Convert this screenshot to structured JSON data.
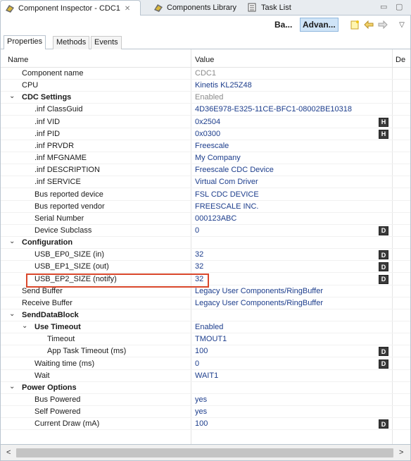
{
  "tabs": [
    {
      "label": "Component Inspector - CDC1",
      "icon": "component-inspector-icon",
      "active": true,
      "close": "✕"
    },
    {
      "label": "Components Library",
      "icon": "components-library-icon",
      "active": false
    },
    {
      "label": "Task List",
      "icon": "task-list-icon",
      "active": false
    }
  ],
  "window_controls": {
    "minimize": "▭",
    "maximize": "▢"
  },
  "toolbar": {
    "basic_label": "Ba...",
    "advanced_label": "Advan...",
    "menu_icon": "▽"
  },
  "subtabs": [
    "Properties",
    "Methods",
    "Events"
  ],
  "columns": {
    "name": "Name",
    "value": "Value",
    "details": "De"
  },
  "rows": [
    {
      "name": "Component name",
      "value": "CDC1",
      "indent": 1,
      "gray": true
    },
    {
      "name": "CPU",
      "value": "Kinetis KL25Z48",
      "indent": 1
    },
    {
      "name": "CDC Settings",
      "value": "Enabled",
      "indent": 0,
      "bold": true,
      "expanded": true,
      "gray": true
    },
    {
      "name": ".inf ClassGuid",
      "value": "4D36E978-E325-11CE-BFC1-08002BE10318",
      "indent": 2
    },
    {
      "name": ".inf VID",
      "value": "0x2504",
      "indent": 2,
      "badge": "H"
    },
    {
      "name": ".inf PID",
      "value": "0x0300",
      "indent": 2,
      "badge": "H"
    },
    {
      "name": ".inf PRVDR",
      "value": "Freescale",
      "indent": 2
    },
    {
      "name": ".inf MFGNAME",
      "value": "My Company",
      "indent": 2
    },
    {
      "name": ".inf DESCRIPTION",
      "value": "Freescale CDC Device",
      "indent": 2
    },
    {
      "name": ".inf SERVICE",
      "value": "Virtual Com Driver",
      "indent": 2
    },
    {
      "name": "Bus reported device",
      "value": "FSL CDC DEVICE",
      "indent": 2
    },
    {
      "name": "Bus reported vendor",
      "value": "FREESCALE INC.",
      "indent": 2
    },
    {
      "name": "Serial Number",
      "value": "000123ABC",
      "indent": 2
    },
    {
      "name": "Device Subclass",
      "value": "0",
      "indent": 2,
      "badge": "D"
    },
    {
      "name": "Configuration",
      "value": "",
      "indent": 0,
      "bold": true,
      "expanded": true
    },
    {
      "name": "USB_EP0_SIZE (in)",
      "value": "32",
      "indent": 2,
      "badge": "D"
    },
    {
      "name": "USB_EP1_SIZE (out)",
      "value": "32",
      "indent": 2,
      "badge": "D"
    },
    {
      "name": "USB_EP2_SIZE (notify)",
      "value": "32",
      "indent": 2,
      "badge": "D"
    },
    {
      "name": "Send Buffer",
      "value": "Legacy User Components/RingBuffer",
      "indent": 1
    },
    {
      "name": "Receive Buffer",
      "value": "Legacy User Components/RingBuffer",
      "indent": 1
    },
    {
      "name": "SendDataBlock",
      "value": "",
      "indent": 0,
      "bold": true,
      "expanded": true
    },
    {
      "name": "Use Timeout",
      "value": "Enabled",
      "indent": 1,
      "bold": true,
      "expanded": true
    },
    {
      "name": "Timeout",
      "value": "TMOUT1",
      "indent": 3
    },
    {
      "name": "App Task Timeout (ms)",
      "value": "100",
      "indent": 3,
      "badge": "D"
    },
    {
      "name": "Waiting time (ms)",
      "value": "0",
      "indent": 2,
      "badge": "D"
    },
    {
      "name": "Wait",
      "value": "WAIT1",
      "indent": 2
    },
    {
      "name": "Power Options",
      "value": "",
      "indent": 0,
      "bold": true,
      "expanded": true
    },
    {
      "name": "Bus Powered",
      "value": "yes",
      "indent": 2
    },
    {
      "name": "Self Powered",
      "value": "yes",
      "indent": 2
    },
    {
      "name": "Current Draw (mA)",
      "value": "100",
      "indent": 2,
      "badge": "D"
    }
  ],
  "scrollbar": {
    "left": "<",
    "right": ">"
  },
  "colors": {
    "value_text": "#1c3d8c",
    "highlight_border": "#d9472b",
    "selected_button": "#cfe4f7"
  }
}
